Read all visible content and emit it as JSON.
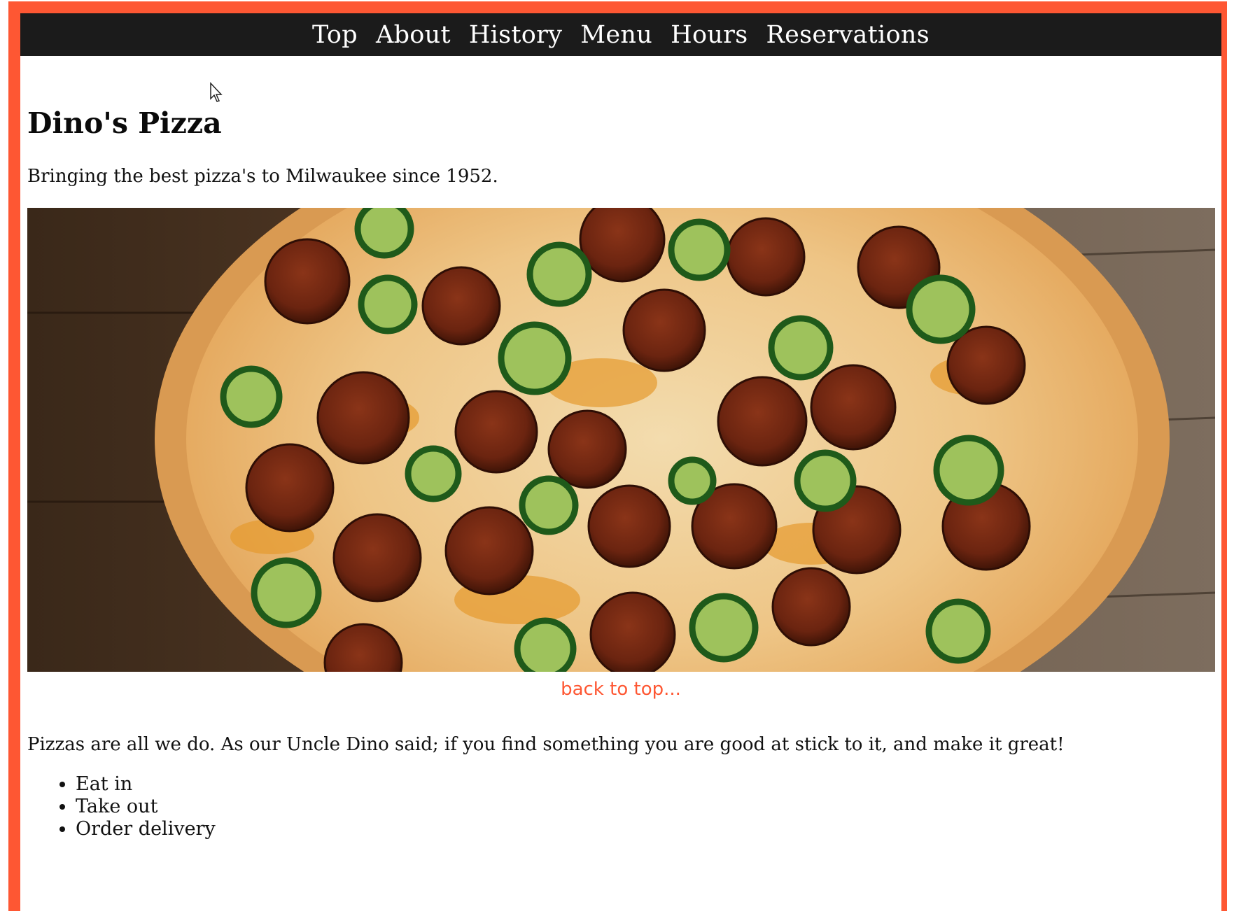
{
  "nav": {
    "items": [
      {
        "label": "Top"
      },
      {
        "label": "About"
      },
      {
        "label": "History"
      },
      {
        "label": "Menu"
      },
      {
        "label": "Hours"
      },
      {
        "label": "Reservations"
      }
    ]
  },
  "header": {
    "title": "Dino's Pizza",
    "tagline": "Bringing the best pizza's to Milwaukee since 1952."
  },
  "hero": {
    "subject": "pepperoni and jalapeño pizza on wooden table"
  },
  "back_link": "back to top...",
  "about": {
    "intro": "Pizzas are all we do. As our Uncle Dino said; if you find something you are good at stick to it, and make it great!",
    "services": [
      "Eat in",
      "Take out",
      "Order delivery"
    ]
  },
  "colors": {
    "accent": "#fe5733",
    "nav_bg": "#1b1b1b",
    "page_bg": "#ffffff"
  }
}
